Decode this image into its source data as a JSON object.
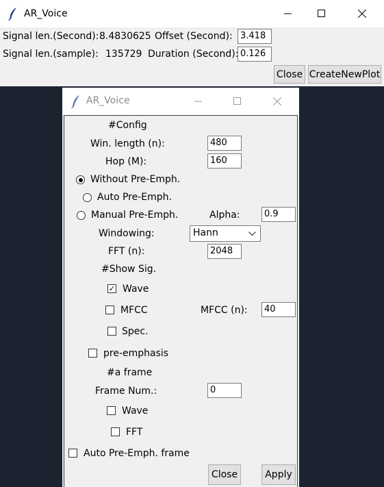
{
  "main_window": {
    "title": "AR_Voice",
    "signal_len_second_label": "Signal len.(Second):",
    "signal_len_second_value": "8.4830625",
    "offset_label": "Offset (Second):",
    "offset_value": "3.418",
    "signal_len_sample_label": "Signal len.(sample):",
    "signal_len_sample_value": "135729",
    "duration_label": "Duration (Second):",
    "duration_value": "0.126",
    "close_label": "Close",
    "create_plot_label": "CreateNewPlot"
  },
  "config_window": {
    "title": "AR_Voice",
    "config_heading": "#Config",
    "win_length_label": "Win. length (n):",
    "win_length_value": "480",
    "hop_label": "Hop (M):",
    "hop_value": "160",
    "radio_without": "Without Pre-Emph.",
    "radio_auto": "Auto Pre-Emph.",
    "radio_manual": "Manual Pre-Emph.",
    "alpha_label": "Alpha:",
    "alpha_value": "0.9",
    "windowing_label": "Windowing:",
    "windowing_value": "Hann",
    "fft_label": "FFT (n):",
    "fft_value": "2048",
    "show_sig_heading": "#Show Sig.",
    "wave_label": "Wave",
    "mfcc_label": "MFCC",
    "mfcc_n_label": "MFCC (n):",
    "mfcc_n_value": "40",
    "spec_label": "Spec.",
    "pre_emphasis_label": "pre-emphasis",
    "a_frame_heading": "#a frame",
    "frame_num_label": "Frame Num.:",
    "frame_num_value": "0",
    "frame_wave_label": "Wave",
    "frame_fft_label": "FFT",
    "auto_pre_emph_frame_label": "Auto Pre-Emph. frame",
    "close_label": "Close",
    "apply_label": "Apply"
  },
  "icons": {
    "app": "feather-icon",
    "minimize": "minimize-icon",
    "maximize": "maximize-icon",
    "close": "close-icon"
  }
}
